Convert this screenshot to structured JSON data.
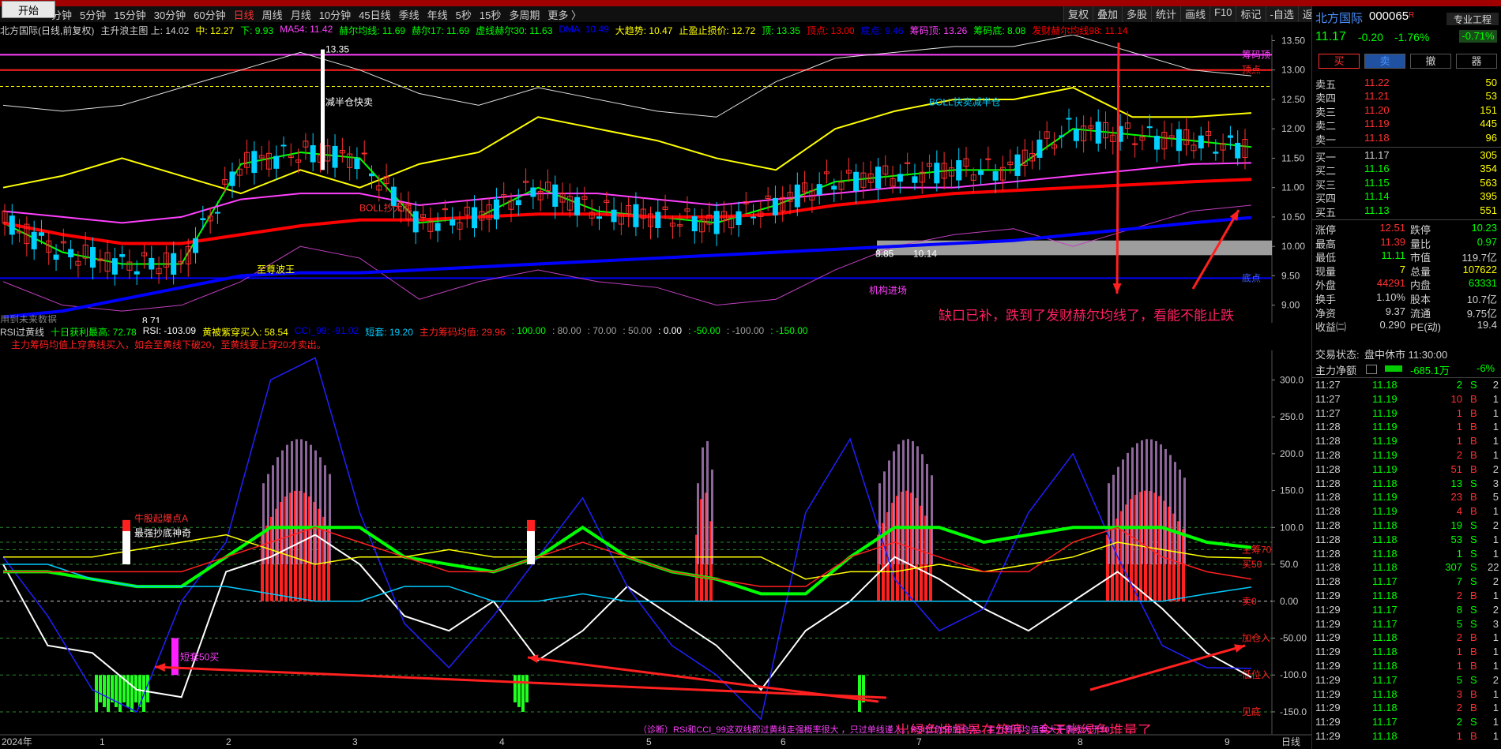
{
  "toolbar": {
    "start": "开始",
    "periods": [
      "分钟",
      "5分钟",
      "15分钟",
      "30分钟",
      "60分钟",
      "日线",
      "周线",
      "月线",
      "10分钟",
      "45日线",
      "季线",
      "年线",
      "5秒",
      "15秒",
      "多周期",
      "更多 〉"
    ],
    "active_period": "日线",
    "right_tools": [
      "复权",
      "叠加",
      "多股",
      "统计",
      "画线",
      "F10",
      "标记",
      "-自选",
      "返回"
    ]
  },
  "main_legend": [
    {
      "text": "北方国际(日线,前复权)",
      "color": "#d0d0d0"
    },
    {
      "text": "主升浪主图 上: 14.02",
      "color": "#d0d0d0"
    },
    {
      "text": "中: 12.27",
      "color": "#ffff00"
    },
    {
      "text": "下: 9.93",
      "color": "#00ff00"
    },
    {
      "text": "MA54: 11.42",
      "color": "#ff40ff"
    },
    {
      "text": "赫尔均线: 11.69",
      "color": "#00ff00"
    },
    {
      "text": "赫尔17: 11.69",
      "color": "#00ff00"
    },
    {
      "text": "虚线赫尔30: 11.63",
      "color": "#00ff00"
    },
    {
      "text": "DMA: 10.49",
      "color": "#0000ff"
    },
    {
      "text": "大趋势: 10.47",
      "color": "#ffff00"
    },
    {
      "text": "止盈止损价: 12.72",
      "color": "#ffff00"
    },
    {
      "text": "顶: 13.35",
      "color": "#00ff00"
    },
    {
      "text": "顶点: 13.00",
      "color": "#ff0000"
    },
    {
      "text": "底点: 9.46",
      "color": "#0000ff"
    },
    {
      "text": "筹码顶: 13.26",
      "color": "#ff40ff"
    },
    {
      "text": "筹码底: 8.08",
      "color": "#00ff00"
    },
    {
      "text": "发财赫尔均线98: 11.14",
      "color": "#ff0000"
    }
  ],
  "main_axis": {
    "labels": [
      "13.50",
      "13.00",
      "12.50",
      "12.00",
      "11.50",
      "11.00",
      "10.50",
      "10.00",
      "9.50",
      "9.00"
    ],
    "right_tags": [
      {
        "text": "筹码顶",
        "color": "#ff40ff"
      },
      {
        "text": "顶点",
        "color": "#ff2020"
      },
      {
        "text": "底点",
        "color": "#4060ff"
      }
    ]
  },
  "main_annotations": [
    {
      "text": "13.35",
      "color": "#ffffff"
    },
    {
      "text": "8.71",
      "color": "#ffffff"
    },
    {
      "text": "8.85",
      "color": "#ffffff"
    },
    {
      "text": "10.14",
      "color": "#ffffff"
    },
    {
      "text": "减半仓快卖",
      "color": "#ffffff"
    },
    {
      "text": "BOLL快卖减半仓",
      "color": "#00ccff"
    },
    {
      "text": "BOLL抄大底",
      "color": "#ff3030"
    },
    {
      "text": "至尊波王",
      "color": "#ffff00"
    },
    {
      "text": "机构进场",
      "color": "#ff40ff"
    },
    {
      "text": "用到未来数据",
      "color": "#808080"
    },
    {
      "text": "缺口已补，跌到了发财赫尔均线了，看能不能止跌",
      "color": "#ff2060"
    }
  ],
  "x_axis": {
    "labels": [
      "2024年",
      "1",
      "2",
      "3",
      "4",
      "5",
      "6",
      "7",
      "8",
      "9"
    ],
    "end": "日线"
  },
  "sub_legend": [
    {
      "text": "RSI过黄线",
      "color": "#d0d0d0"
    },
    {
      "text": "十日获利最高: 72.78",
      "color": "#00ff00"
    },
    {
      "text": "RSI: -103.09",
      "color": "#ffffff"
    },
    {
      "text": "黄被紫穿买入: 58.54",
      "color": "#ffff00"
    },
    {
      "text": "CCI_99: -91.02",
      "color": "#0000ff"
    },
    {
      "text": "短套: 19.20",
      "color": "#00ccff"
    },
    {
      "text": "主力筹码均值: 29.96",
      "color": "#ff2020"
    },
    {
      "text": ": 100.00",
      "color": "#00ff00"
    },
    {
      "text": ": 80.00",
      "color": "#a0a0a0"
    },
    {
      "text": ": 70.00",
      "color": "#a0a0a0"
    },
    {
      "text": ": 50.00",
      "color": "#a0a0a0"
    },
    {
      "text": ": 0.00",
      "color": "#ffffff"
    },
    {
      "text": ": -50.00",
      "color": "#00ff00"
    },
    {
      "text": ": -100.00",
      "color": "#a0a0a0"
    },
    {
      "text": ": -150.00",
      "color": "#00ff00"
    }
  ],
  "sub_note": "主力筹码均值上穿黄线买入，如会至黄线下破20，至黄线要上穿20才卖出。",
  "sub_axis": {
    "labels": [
      "300.0",
      "250.0",
      "200.0",
      "150.0",
      "100.0",
      "50.0",
      "0.00",
      "-50.00",
      "-100.0",
      "-150.0"
    ],
    "tags": [
      {
        "text": "主筹70",
        "color": "#ff2020"
      },
      {
        "text": "买50",
        "color": "#ff2020"
      },
      {
        "text": "卖0",
        "color": "#ff2020"
      },
      {
        "text": "加仓入",
        "color": "#ff2020"
      },
      {
        "text": "低位入",
        "color": "#ff2020"
      },
      {
        "text": "见底",
        "color": "#ff2020"
      }
    ]
  },
  "sub_annotations": [
    {
      "text": "牛股起爆点A",
      "color": "#ff3030"
    },
    {
      "text": "最强抄底神奇",
      "color": "#ffffff"
    },
    {
      "text": "短套50买",
      "color": "#ff40ff"
    },
    {
      "text": "出绿色堆量是在筑底，今天出绿色堆量了",
      "color": "#ff2060"
    },
    {
      "text": "（诊断）RSI和CCI_99这双线都过黄线走强概率很大 ，只过单线谨入。RSI过负50加仓入。主力筹码均值要大于黄线大于50",
      "color": "#ff40ff"
    }
  ],
  "stock": {
    "name": "北方国际",
    "code": "000065",
    "flag": "R",
    "extra": "专业工程",
    "price": "11.17",
    "change": "-0.20",
    "pct": "-1.76%",
    "badge": "-0.71%"
  },
  "trade_buttons": [
    "买",
    "卖",
    "撤",
    "器"
  ],
  "asks": [
    {
      "label": "卖五",
      "price": "11.22",
      "vol": "50"
    },
    {
      "label": "卖四",
      "price": "11.21",
      "vol": "53"
    },
    {
      "label": "卖三",
      "price": "11.20",
      "vol": "151"
    },
    {
      "label": "卖二",
      "price": "11.19",
      "vol": "445"
    },
    {
      "label": "卖一",
      "price": "11.18",
      "vol": "96"
    }
  ],
  "bids": [
    {
      "label": "买一",
      "price": "11.17",
      "vol": "305"
    },
    {
      "label": "买二",
      "price": "11.16",
      "vol": "354"
    },
    {
      "label": "买三",
      "price": "11.15",
      "vol": "563"
    },
    {
      "label": "买四",
      "price": "11.14",
      "vol": "395"
    },
    {
      "label": "买五",
      "price": "11.13",
      "vol": "551"
    }
  ],
  "stats": [
    {
      "l1": "涨停",
      "v1": "12.51",
      "c1": "#ff3030",
      "l2": "跌停",
      "v2": "10.23",
      "c2": "#00ff00"
    },
    {
      "l1": "最高",
      "v1": "11.39",
      "c1": "#ff3030",
      "l2": "量比",
      "v2": "0.97",
      "c2": "#00ff00"
    },
    {
      "l1": "最低",
      "v1": "11.11",
      "c1": "#00ff00",
      "l2": "市值",
      "v2": "119.7亿",
      "c2": "#d0d0d0"
    },
    {
      "l1": "现量",
      "v1": "7",
      "c1": "#ffff00",
      "l2": "总量",
      "v2": "107622",
      "c2": "#ffff00"
    },
    {
      "l1": "外盘",
      "v1": "44291",
      "c1": "#ff3030",
      "l2": "内盘",
      "v2": "63331",
      "c2": "#00ff00"
    },
    {
      "l1": "换手",
      "v1": "1.10%",
      "c1": "#d0d0d0",
      "l2": "股本",
      "v2": "10.7亿",
      "c2": "#d0d0d0"
    },
    {
      "l1": "净资",
      "v1": "9.37",
      "c1": "#d0d0d0",
      "l2": "流通",
      "v2": "9.75亿",
      "c2": "#d0d0d0"
    },
    {
      "l1": "收益㈡",
      "v1": "0.290",
      "c1": "#d0d0d0",
      "l2": "PE(动)",
      "v2": "19.4",
      "c2": "#d0d0d0"
    }
  ],
  "status": {
    "label": "交易状态:",
    "value": "盘中休市 11:30:00"
  },
  "netflow": {
    "label": "主力净额",
    "value": "-685.1万",
    "pct": "-6%"
  },
  "ticks": [
    {
      "t": "11:27",
      "p": "11.18",
      "v": "2",
      "s": "S",
      "n": "2"
    },
    {
      "t": "11:27",
      "p": "11.19",
      "v": "10",
      "s": "B",
      "n": "1"
    },
    {
      "t": "11:27",
      "p": "11.19",
      "v": "1",
      "s": "B",
      "n": "1"
    },
    {
      "t": "11:28",
      "p": "11.19",
      "v": "1",
      "s": "B",
      "n": "1"
    },
    {
      "t": "11:28",
      "p": "11.19",
      "v": "1",
      "s": "B",
      "n": "1"
    },
    {
      "t": "11:28",
      "p": "11.19",
      "v": "2",
      "s": "B",
      "n": "1"
    },
    {
      "t": "11:28",
      "p": "11.19",
      "v": "51",
      "s": "B",
      "n": "2"
    },
    {
      "t": "11:28",
      "p": "11.18",
      "v": "13",
      "s": "S",
      "n": "3"
    },
    {
      "t": "11:28",
      "p": "11.19",
      "v": "23",
      "s": "B",
      "n": "5"
    },
    {
      "t": "11:28",
      "p": "11.19",
      "v": "4",
      "s": "B",
      "n": "1"
    },
    {
      "t": "11:28",
      "p": "11.18",
      "v": "19",
      "s": "S",
      "n": "2"
    },
    {
      "t": "11:28",
      "p": "11.18",
      "v": "53",
      "s": "S",
      "n": "1"
    },
    {
      "t": "11:28",
      "p": "11.18",
      "v": "1",
      "s": "S",
      "n": "1"
    },
    {
      "t": "11:28",
      "p": "11.18",
      "v": "307",
      "s": "S",
      "n": "22"
    },
    {
      "t": "11:28",
      "p": "11.17",
      "v": "7",
      "s": "S",
      "n": "2"
    },
    {
      "t": "11:29",
      "p": "11.18",
      "v": "2",
      "s": "B",
      "n": "1"
    },
    {
      "t": "11:29",
      "p": "11.17",
      "v": "8",
      "s": "S",
      "n": "2"
    },
    {
      "t": "11:29",
      "p": "11.17",
      "v": "5",
      "s": "S",
      "n": "3"
    },
    {
      "t": "11:29",
      "p": "11.18",
      "v": "2",
      "s": "B",
      "n": "1"
    },
    {
      "t": "11:29",
      "p": "11.18",
      "v": "1",
      "s": "B",
      "n": "1"
    },
    {
      "t": "11:29",
      "p": "11.18",
      "v": "1",
      "s": "B",
      "n": "1"
    },
    {
      "t": "11:29",
      "p": "11.17",
      "v": "5",
      "s": "S",
      "n": "2"
    },
    {
      "t": "11:29",
      "p": "11.18",
      "v": "3",
      "s": "B",
      "n": "1"
    },
    {
      "t": "11:29",
      "p": "11.18",
      "v": "2",
      "s": "B",
      "n": "1"
    },
    {
      "t": "11:29",
      "p": "11.17",
      "v": "2",
      "s": "S",
      "n": "1"
    },
    {
      "t": "11:29",
      "p": "11.18",
      "v": "1",
      "s": "B",
      "n": "1"
    }
  ],
  "chart_data": [
    {
      "type": "line",
      "title": "主升浪主图",
      "y_range": [
        8.7,
        13.6
      ],
      "x_range": [
        "2024-01",
        "2024-09"
      ],
      "series": [
        {
          "name": "中",
          "values": [
            11.0,
            11.2,
            11.5,
            11.2,
            10.9,
            11.3,
            11.0,
            11.4,
            11.6,
            12.2,
            12.0,
            11.8,
            11.5,
            11.3,
            12.0,
            12.3,
            12.5,
            12.5,
            12.7,
            12.2,
            12.2,
            12.27
          ],
          "color": "#ffff00"
        },
        {
          "name": "赫尔均线",
          "values": [
            10.4,
            9.9,
            9.7,
            9.7,
            11.4,
            11.6,
            11.5,
            10.4,
            10.5,
            11.0,
            10.6,
            10.5,
            10.4,
            10.7,
            11.1,
            11.2,
            11.3,
            11.3,
            12.0,
            11.9,
            11.8,
            11.69
          ],
          "color": "#00ff00"
        },
        {
          "name": "MA54",
          "values": [
            10.6,
            10.5,
            10.4,
            10.5,
            10.8,
            10.9,
            10.9,
            10.7,
            10.8,
            10.9,
            10.9,
            10.8,
            10.7,
            10.8,
            10.9,
            11.0,
            11.0,
            11.1,
            11.2,
            11.3,
            11.4,
            11.42
          ],
          "color": "#ff40ff"
        },
        {
          "name": "发财赫尔均线98",
          "values": [
            10.4,
            10.2,
            10.05,
            10.05,
            10.2,
            10.35,
            10.45,
            10.45,
            10.5,
            10.55,
            10.55,
            10.5,
            10.5,
            10.55,
            10.7,
            10.8,
            10.9,
            10.95,
            11.0,
            11.05,
            11.1,
            11.14
          ],
          "color": "#ff0000"
        },
        {
          "name": "DMA",
          "values": [
            8.8,
            8.9,
            9.1,
            9.3,
            9.5,
            9.55,
            9.55,
            9.6,
            9.65,
            9.7,
            9.75,
            9.8,
            9.85,
            9.9,
            9.95,
            10.0,
            10.05,
            10.1,
            10.2,
            10.3,
            10.4,
            10.49
          ],
          "color": "#0000ff"
        }
      ],
      "hlines": [
        {
          "name": "筹码顶",
          "value": 13.26,
          "color": "#ff40ff"
        },
        {
          "name": "顶点",
          "value": 13.0,
          "color": "#ff2020"
        },
        {
          "name": "止盈止损价",
          "value": 12.72,
          "color": "#ffff00"
        },
        {
          "name": "底点",
          "value": 9.46,
          "color": "#0000ff"
        }
      ]
    },
    {
      "type": "line",
      "title": "RSI过黄线",
      "y_range": [
        -180,
        340
      ],
      "series": [
        {
          "name": "RSI",
          "values": [
            50,
            -60,
            -70,
            -120,
            -130,
            40,
            60,
            90,
            50,
            -20,
            -40,
            0,
            -80,
            -40,
            20,
            -20,
            -60,
            -120,
            -40,
            0,
            60,
            30,
            -10,
            -40,
            0,
            40,
            -10,
            -70,
            -103.09
          ],
          "color": "#ffffff"
        },
        {
          "name": "CCI_99",
          "values": [
            60,
            -20,
            -120,
            -150,
            0,
            80,
            300,
            330,
            120,
            -30,
            -90,
            -20,
            60,
            140,
            20,
            -60,
            -100,
            -160,
            120,
            220,
            30,
            -40,
            -10,
            120,
            200,
            60,
            -60,
            -90,
            -91.02
          ],
          "color": "#2020ff"
        },
        {
          "name": "十日获利最高",
          "values": [
            40,
            40,
            30,
            20,
            20,
            60,
            100,
            100,
            100,
            60,
            50,
            40,
            60,
            100,
            60,
            40,
            30,
            10,
            10,
            60,
            100,
            100,
            80,
            90,
            100,
            100,
            100,
            80,
            72.78
          ],
          "color": "#00ff00"
        },
        {
          "name": "黄被紫穿买入",
          "values": [
            60,
            60,
            60,
            70,
            80,
            90,
            70,
            50,
            60,
            60,
            70,
            60,
            60,
            60,
            60,
            60,
            60,
            60,
            30,
            40,
            40,
            50,
            40,
            50,
            60,
            80,
            70,
            60,
            58.54
          ],
          "color": "#ffff00"
        },
        {
          "name": "短套",
          "values": [
            50,
            50,
            30,
            20,
            20,
            20,
            10,
            0,
            0,
            20,
            20,
            0,
            0,
            10,
            0,
            0,
            0,
            0,
            0,
            0,
            0,
            0,
            0,
            0,
            0,
            0,
            0,
            10,
            19.2
          ],
          "color": "#00ccff"
        },
        {
          "name": "主力筹码均值",
          "values": [
            40,
            40,
            40,
            40,
            40,
            60,
            80,
            100,
            80,
            60,
            40,
            40,
            60,
            80,
            60,
            40,
            30,
            20,
            20,
            60,
            80,
            60,
            40,
            40,
            80,
            100,
            60,
            40,
            29.96
          ],
          "color": "#ff2020"
        }
      ],
      "hlines": [
        100,
        80,
        70,
        50,
        0,
        -50,
        -100,
        -150
      ]
    }
  ]
}
